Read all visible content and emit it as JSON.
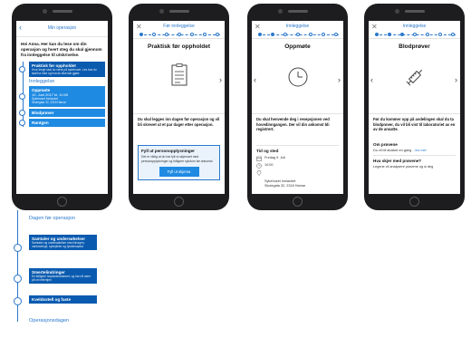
{
  "accent": "#2a78cc",
  "card_dark": "#0a5bb0",
  "card_mid": "#1f8ae2",
  "screen1": {
    "back_icon": "chevron-left-icon",
    "title": "Min operasjon",
    "intro": "Hei Anna. Her kan du lese om din operasjon og hvert steg du skal gjennom fra innleggelse til utskrivelse.",
    "card_top": {
      "title": "Praktisk før oppholdet",
      "desc": "Hvor lenge skal du være på sykehuset. Les hva du skal ha med og hva du ikke bør gjøre."
    },
    "section": "Innleggelse",
    "card_oppmote": {
      "title": "Oppmøte",
      "date": "10. Juni 2017 kl. 10:00",
      "desc": "Sykehuset Innlandet\nSkolegata 32, 2318 Hamar"
    },
    "card_blod": {
      "title": "Blodprøver"
    },
    "card_rontgen": {
      "title": "Røntgen"
    }
  },
  "screen2": {
    "close_icon": "close-icon",
    "title": "Før innleggelse",
    "heading": "Praktisk før oppholdet",
    "body": "Du skal legges inn dagen før operasjon og vil bli skrevet ut et par dager etter operasjon.",
    "box_title": "Fyll ut personopplysninger",
    "box_desc": "Det er viktig at du har fylt ut skjemaet med personopplysninger og tidligere sykdom før ankomst",
    "box_button": "Fyll ut skjema"
  },
  "screen3": {
    "close_icon": "close-icon",
    "title": "Innleggelse",
    "heading": "Oppmøte",
    "body": "Du skal henvende deg i resepsjonen ved hovedinngangen. Der vil din ankomst bli registrert.",
    "sub": "Tid og sted",
    "date": "Fredag 9. Juli",
    "time": "10:00",
    "place": "Sykehuset Innlandet\nSkolegata 32, 2318 Hamar"
  },
  "screen4": {
    "close_icon": "close-icon",
    "title": "Innleggelse",
    "heading": "Blodprøver",
    "body": "Før du kommer opp på avdelingen skal du ta blodprøver, du vil bli vist til laboratoriet av en av de ansatte.",
    "sub1": "Om prøvene",
    "row1_text": "Du vil bli stukket en gang",
    "row1_link": "...les mer",
    "sub2": "Hva skjer med prøvene?",
    "row2_text": "Legene vil analysere prøvene og si deg"
  },
  "timeline_ext": {
    "section1": "Dagen før operasjon",
    "card1": {
      "title": "Samtaler og undersøkelser",
      "desc": "Samtaler og undersøkelser med kirurgen, narkoselege, sykepleier og fysioterapeut"
    },
    "card2": {
      "title": "Smertelindringer",
      "desc": "En tidligere hoyskoleutdannet, og har nå være på vei etterhjen"
    },
    "card3": {
      "title": "Kveldsstell og faste"
    },
    "section2": "Operasjonsdagen"
  }
}
